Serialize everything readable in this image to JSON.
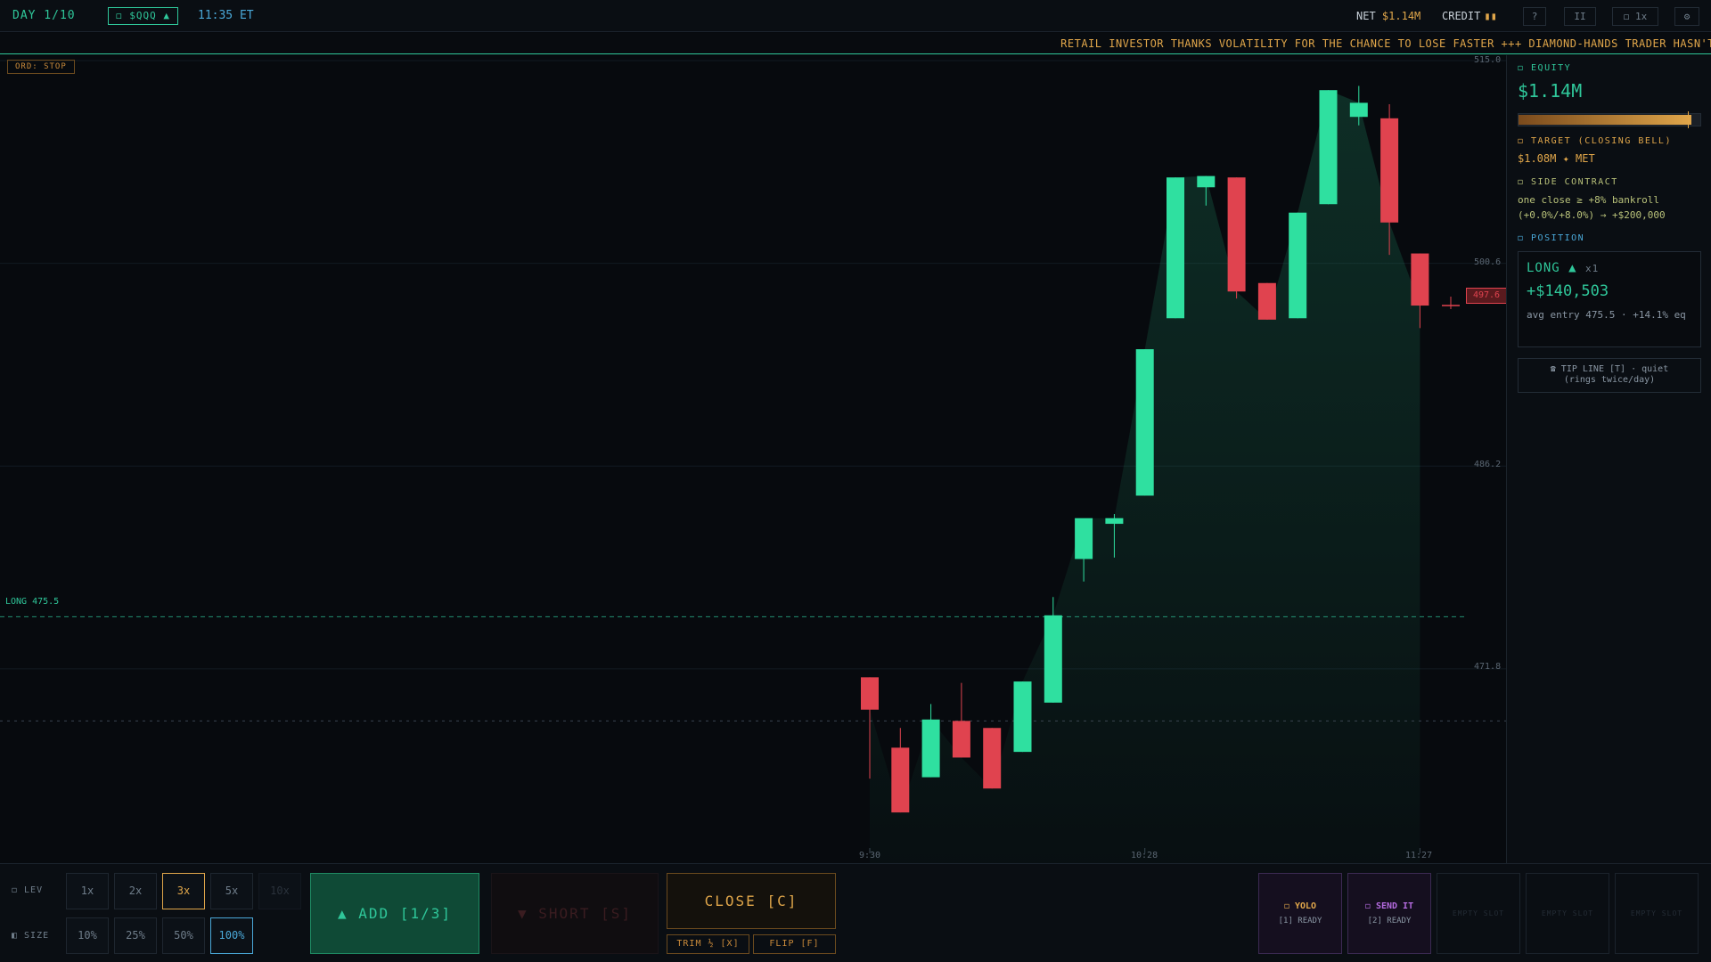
{
  "topbar": {
    "day": "DAY 1/10",
    "ticker": "◻ $QQQ ▲",
    "time": "11:35 ET",
    "net_label": "NET",
    "net_value": "$1.14M",
    "credit_label": "CREDIT",
    "credit_bars": "▮▮",
    "help": "?",
    "pause": "II",
    "speed": "◻ 1x",
    "settings": "⚙"
  },
  "tape": {
    "text": "RETAIL INVESTOR THANKS VOLATILITY FOR THE CHANCE TO LOSE FASTER +++ DIAMOND-HANDS TRADER HASN'T"
  },
  "chart": {
    "order_badge": "ORD: STOP",
    "entry_label": "LONG 475.5",
    "price_tag": "497.6",
    "y_ticks": [
      "515.0",
      "500.6",
      "486.2",
      "471.8"
    ],
    "x_ticks": [
      "9:30",
      "10:28",
      "11:27"
    ]
  },
  "chart_data": {
    "type": "candlestick",
    "ylim": [
      458,
      515
    ],
    "y_ticks": [
      515.0,
      500.6,
      486.2,
      471.8
    ],
    "x_ticks": [
      "9:30",
      "10:28",
      "11:27"
    ],
    "entry_price": 475.5,
    "last_price": 497.6,
    "candles": [
      {
        "o": 471.2,
        "h": 471.2,
        "l": 464.0,
        "c": 468.9
      },
      {
        "o": 466.2,
        "h": 467.6,
        "l": 461.6,
        "c": 461.6
      },
      {
        "o": 464.1,
        "h": 469.3,
        "l": 464.1,
        "c": 468.2
      },
      {
        "o": 468.1,
        "h": 470.8,
        "l": 465.5,
        "c": 465.5
      },
      {
        "o": 467.6,
        "h": 467.6,
        "l": 463.3,
        "c": 463.3
      },
      {
        "o": 465.9,
        "h": 470.9,
        "l": 465.9,
        "c": 470.9
      },
      {
        "o": 469.4,
        "h": 476.9,
        "l": 469.4,
        "c": 475.6
      },
      {
        "o": 479.6,
        "h": 479.6,
        "l": 478.0,
        "c": 482.5
      },
      {
        "o": 482.1,
        "h": 482.8,
        "l": 479.7,
        "c": 482.5
      },
      {
        "o": 484.1,
        "h": 494.5,
        "l": 484.1,
        "c": 494.5
      },
      {
        "o": 496.7,
        "h": 506.7,
        "l": 496.7,
        "c": 506.7
      },
      {
        "o": 506.0,
        "h": 506.8,
        "l": 504.7,
        "c": 506.8
      },
      {
        "o": 506.7,
        "h": 506.7,
        "l": 498.1,
        "c": 498.6
      },
      {
        "o": 499.2,
        "h": 499.2,
        "l": 496.6,
        "c": 496.6
      },
      {
        "o": 496.7,
        "h": 504.2,
        "l": 496.7,
        "c": 504.2
      },
      {
        "o": 504.8,
        "h": 512.9,
        "l": 504.8,
        "c": 512.9
      },
      {
        "o": 511.0,
        "h": 513.2,
        "l": 510.4,
        "c": 512.0
      },
      {
        "o": 510.9,
        "h": 511.9,
        "l": 501.2,
        "c": 503.5
      },
      {
        "o": 501.3,
        "h": 501.3,
        "l": 496.0,
        "c": 497.6
      }
    ]
  },
  "panel": {
    "equity_label": "◻ EQUITY",
    "equity_value": "$1.14M",
    "equity_fill": 0.95,
    "equity_target_fraction": 0.93,
    "target_label": "◻ TARGET (CLOSING BELL)",
    "target_value": "$1.08M ✦ MET",
    "side_label": "◻ SIDE CONTRACT",
    "side_line1": "one close ≥ +8% bankroll",
    "side_line2": "(+0.0%/+8.0%) → +$200,000",
    "position_label": "◻ POSITION",
    "position_dir": "LONG ▲",
    "position_mult": "x1",
    "position_pnl": "+$140,503",
    "position_avg": "avg entry 475.5 · +14.1% eq",
    "tip_line1": "☎ TIP LINE [T] · quiet",
    "tip_line2": "(rings twice/day)"
  },
  "bottom": {
    "lev_label": "◻ LEV",
    "size_label": "◧ SIZE",
    "lev_options": [
      "1x",
      "2x",
      "3x",
      "5x",
      "10x"
    ],
    "size_options": [
      "10%",
      "25%",
      "50%",
      "100%"
    ],
    "add_label": "▲ ADD [1/3]",
    "short_label": "▼ SHORT [S]",
    "close_label": "CLOSE [C]",
    "trim_label": "TRIM ½ [X]",
    "flip_label": "FLIP [F]",
    "slots": [
      {
        "name": "◻ YOLO",
        "status": "[1] READY",
        "color": "#e0a64a"
      },
      {
        "name": "◻ SEND IT",
        "status": "[2] READY",
        "color": "#b56be0"
      }
    ],
    "empty_slot": "EMPTY SLOT"
  },
  "colors": {
    "up": "#2fe0a0",
    "down": "#e0434f",
    "accent": "#2fc79a",
    "gold": "#e0a64a",
    "blue": "#4aa8d8"
  }
}
